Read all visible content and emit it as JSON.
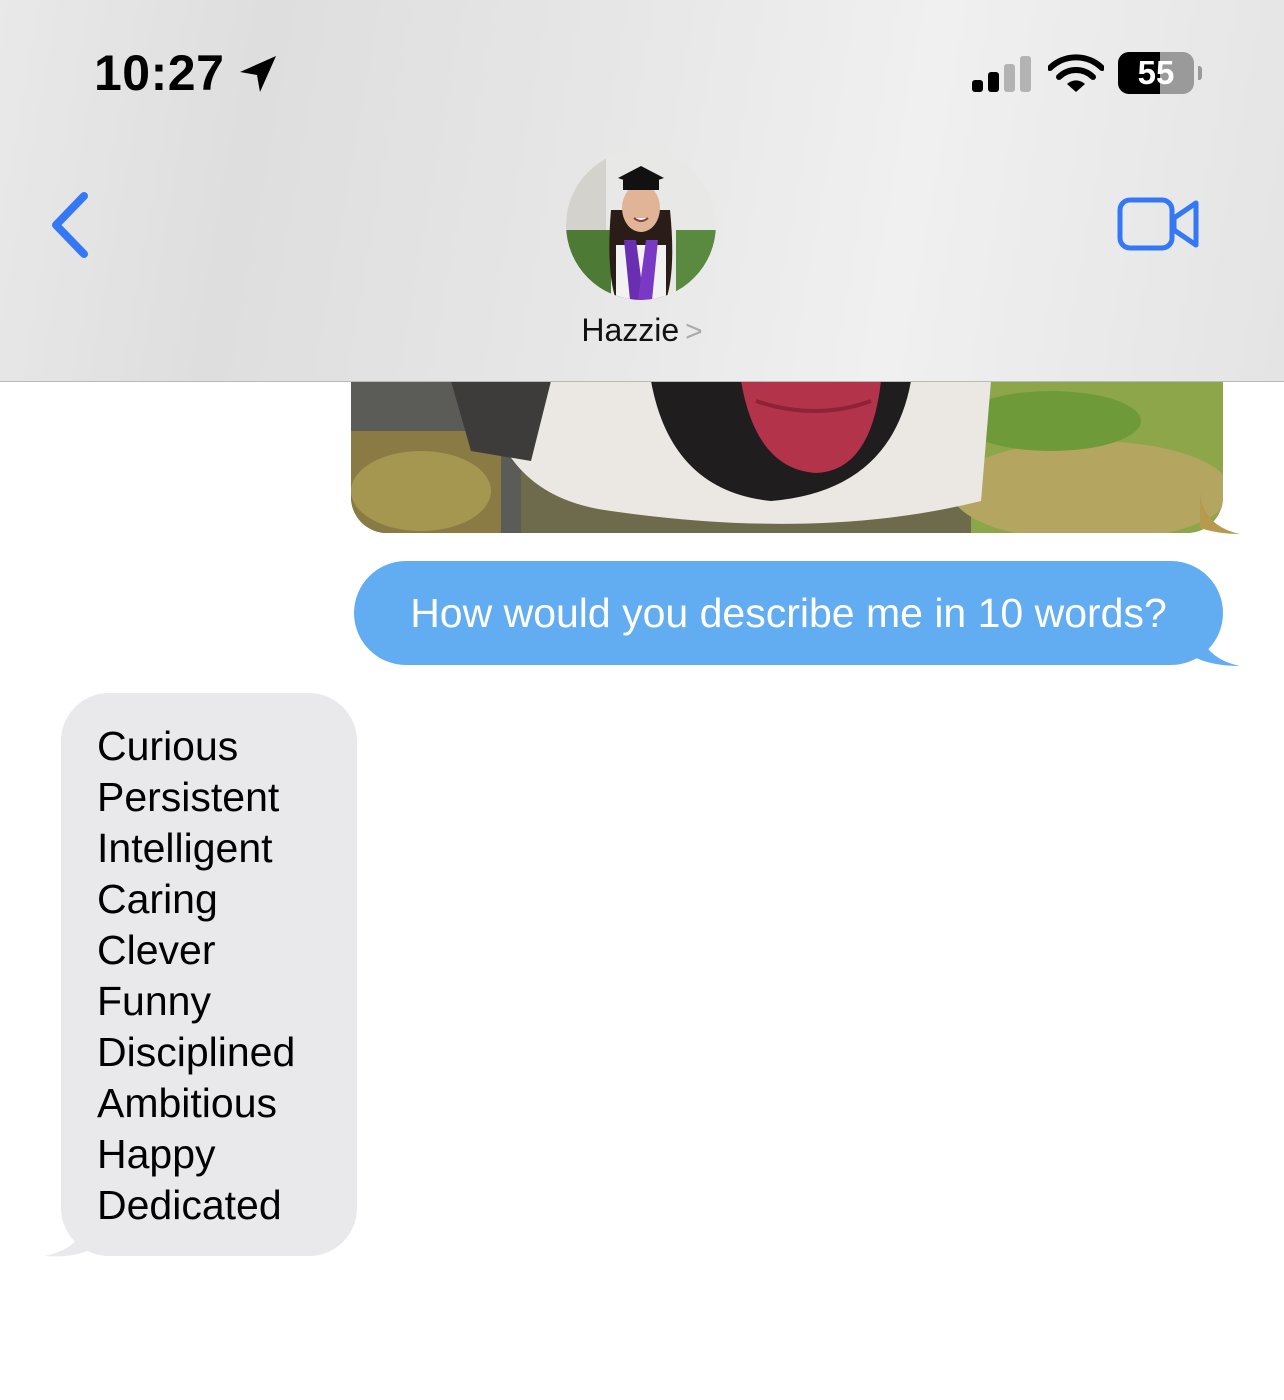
{
  "status_bar": {
    "time": "10:27",
    "location_icon": "location-arrow-icon",
    "signal_icon": "cellular-signal-icon",
    "wifi_icon": "wifi-icon",
    "battery_level": "55",
    "battery_fraction": 0.55
  },
  "nav": {
    "back_icon": "chevron-left-icon",
    "contact_name": "Hazzie",
    "contact_chevron": ">",
    "video_icon": "video-camera-icon",
    "accent_color": "#3478f6"
  },
  "messages": {
    "photo_message": "dog-photo-image",
    "outgoing_text": "How would you describe me in 10 words?",
    "outgoing_color": "#62acf2",
    "incoming_words": [
      "Curious",
      "Persistent",
      "Intelligent",
      "Caring",
      "Clever",
      "Funny",
      "Disciplined",
      "Ambitious",
      "Happy",
      "Dedicated"
    ],
    "incoming_color": "#e9e9eb"
  }
}
